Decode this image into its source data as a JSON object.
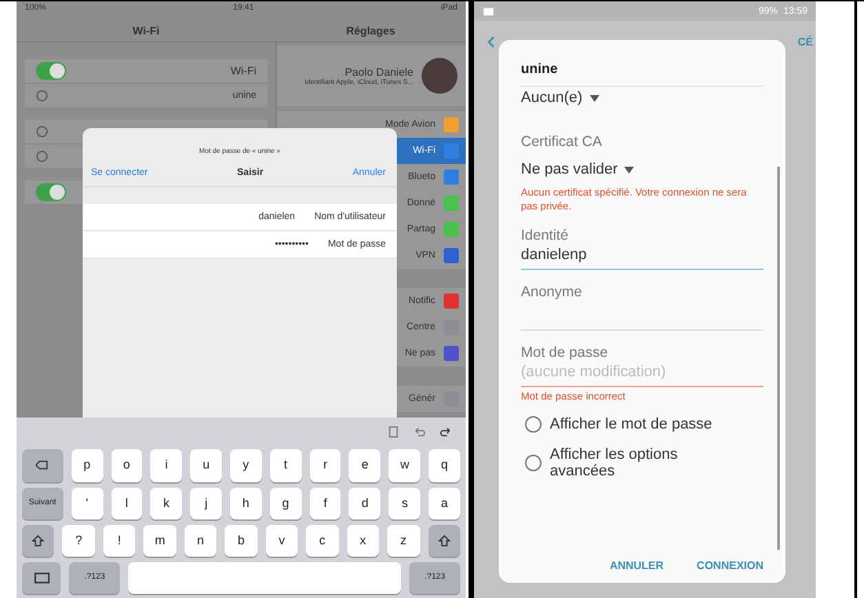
{
  "ipad": {
    "status_bar": {
      "battery": "100%",
      "time": "19:41",
      "device": "iPad"
    },
    "wifi_title": "Wi-Fi",
    "settings_title": "Réglages",
    "profile": {
      "name": "Paolo Daniele",
      "subtitle": "Identifiant Apple, iCloud, iTunes S..."
    },
    "wifi_toggle": {
      "label": "Wi-Fi",
      "on": true
    },
    "current_network": {
      "name": "unine"
    },
    "ask_toggle": {
      "on": true
    },
    "sidebar": [
      {
        "label": "Mode Avion",
        "selected": false,
        "color": "#f0a030"
      },
      {
        "label": "Wi-Fi",
        "selected": true,
        "color": "#2f7fe0"
      },
      {
        "label": "Blueto",
        "selected": false,
        "color": "#2f7fe0"
      },
      {
        "label": "Donné",
        "selected": false,
        "color": "#4cc04c"
      },
      {
        "label": "Partag",
        "selected": false,
        "color": "#4cc04c"
      },
      {
        "label": "VPN",
        "selected": false,
        "color": "#2f60d0"
      },
      {
        "label": "Notific",
        "selected": false,
        "color": "#e03030"
      },
      {
        "label": "Centre",
        "selected": false,
        "color": "#8e8e93"
      },
      {
        "label": "Ne pas",
        "selected": false,
        "color": "#5050c8"
      },
      {
        "label": "Génér",
        "selected": false,
        "color": "#8e8e93"
      }
    ],
    "dialog": {
      "title": "Mot de passe de « unine »",
      "connect": "Se connecter",
      "heading": "Saisir",
      "cancel": "Annuler",
      "fields": [
        {
          "label": "Nom d'utilisateur",
          "value": "danielen"
        },
        {
          "label": "Mot de passe",
          "value": "••••••••••"
        }
      ]
    },
    "keyboard": {
      "rows": [
        [
          {
            "kind": "delete"
          },
          {
            "kind": "char",
            "label": "p"
          },
          {
            "kind": "char",
            "label": "o"
          },
          {
            "kind": "char",
            "label": "i"
          },
          {
            "kind": "char",
            "label": "u"
          },
          {
            "kind": "char",
            "label": "y"
          },
          {
            "kind": "char",
            "label": "t"
          },
          {
            "kind": "char",
            "label": "r"
          },
          {
            "kind": "char",
            "label": "e"
          },
          {
            "kind": "char",
            "label": "w"
          },
          {
            "kind": "char",
            "label": "q"
          }
        ],
        [
          {
            "kind": "action",
            "label": "Suivant"
          },
          {
            "kind": "char",
            "label": "'"
          },
          {
            "kind": "char",
            "label": "l"
          },
          {
            "kind": "char",
            "label": "k"
          },
          {
            "kind": "char",
            "label": "j"
          },
          {
            "kind": "char",
            "label": "h"
          },
          {
            "kind": "char",
            "label": "g"
          },
          {
            "kind": "char",
            "label": "f"
          },
          {
            "kind": "char",
            "label": "d"
          },
          {
            "kind": "char",
            "label": "s"
          },
          {
            "kind": "char",
            "label": "a"
          }
        ],
        [
          {
            "kind": "shift"
          },
          {
            "kind": "char",
            "label": "?"
          },
          {
            "kind": "char",
            "label": "!"
          },
          {
            "kind": "char",
            "label": "m"
          },
          {
            "kind": "char",
            "label": "n"
          },
          {
            "kind": "char",
            "label": "b"
          },
          {
            "kind": "char",
            "label": "v"
          },
          {
            "kind": "char",
            "label": "c"
          },
          {
            "kind": "char",
            "label": "x"
          },
          {
            "kind": "char",
            "label": "z"
          },
          {
            "kind": "shift"
          }
        ],
        [
          {
            "kind": "hide"
          },
          {
            "kind": "action",
            "label": ".?123"
          },
          {
            "kind": "space"
          },
          {
            "kind": "action",
            "label": ".?123"
          }
        ]
      ]
    }
  },
  "android": {
    "status_bar": {
      "battery": "99%",
      "time": "13:59"
    },
    "background_action": "CÉ",
    "dialog": {
      "network": "unine",
      "method": "Aucun(e)",
      "ca_label": "Certificat CA",
      "ca_value": "Ne pas valider",
      "ca_error": "Aucun certificat spécifié. Votre connexion ne sera pas privée.",
      "identity": {
        "label": "Identité",
        "value": "danielenp"
      },
      "anonymous": {
        "label": "Anonyme"
      },
      "password": {
        "label": "Mot de passe",
        "placeholder": "(aucune modification)",
        "error": "Mot de passe incorrect"
      },
      "options": [
        {
          "label": "Afficher le mot de passe",
          "selected": false
        },
        {
          "label": "Afficher les options avancées",
          "selected": false
        }
      ],
      "buttons": [
        "ANNULER",
        "CONNEXION"
      ]
    }
  }
}
